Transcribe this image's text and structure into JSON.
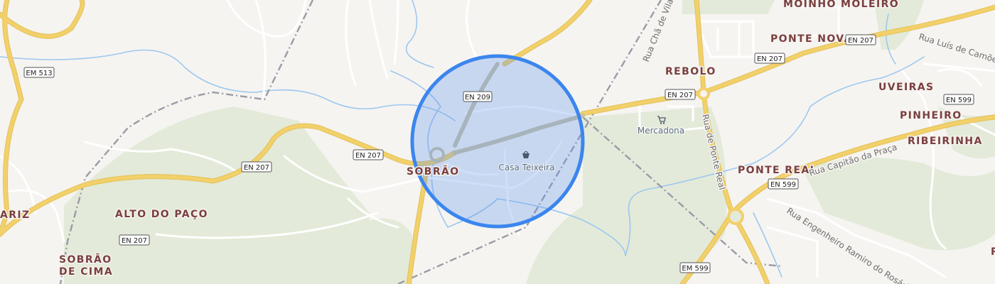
{
  "colors": {
    "background": "#f6f4f1",
    "park": "#e3ead9",
    "water": "#9cc8ef",
    "major_road": "#f2d06a",
    "minor_road": "#ffffff",
    "boundary": "#9b9ba6",
    "place_label": "#7a3f3f",
    "radius_fill": "rgba(92,150,238,0.30)",
    "radius_stroke": "#3b86ee"
  },
  "places": {
    "moinho_moleiro": "MOINHO MOLEIRO",
    "ponte_nova": "PONTE NOVA",
    "rebolo": "REBOLO",
    "uveiras": "UVEIRAS",
    "pinheiro": "PINHEIRO",
    "ribeirinha": "RIBEIRINHA",
    "ponte_real": "PONTE REAL",
    "sobrao": "SOBRÃO",
    "alto_do_paco": "ALTO DO PAÇO",
    "sobrao_de_cima_1": "SOBRÃO",
    "sobrao_de_cima_2": "DE CIMA",
    "ariz": "ARIZ"
  },
  "streets": {
    "rua_cha_de_vilar": "Rua Chã de Vilar",
    "rua_luis_de_camoes": "Rua Luís de Camões",
    "rua_de_ponte_real": "Rua de Ponte Real",
    "rua_capitao_da_praca": "Rua Capitão da Praça",
    "rua_engenheiro_ramiro": "Rua Engenheiro Ramiro do Rosário"
  },
  "shields": {
    "em513": "EM 513",
    "en209": "EN 209",
    "en207_sobrao": "EN 207",
    "en207_west": "EN 207",
    "en207_alto": "EN 207",
    "en207_rebolo": "EN 207",
    "en207_pn1": "EN 207",
    "en207_pn2": "EN 207",
    "en599_ponte_real": "EN 599",
    "en599_pinheiro": "EN 599",
    "em599": "EM 599"
  },
  "pois": {
    "casa_teixeira": {
      "label": "Casa Teixeira",
      "icon": "shopping-basket-icon"
    },
    "mercadona": {
      "label": "Mercadona",
      "icon": "shopping-cart-icon"
    }
  }
}
